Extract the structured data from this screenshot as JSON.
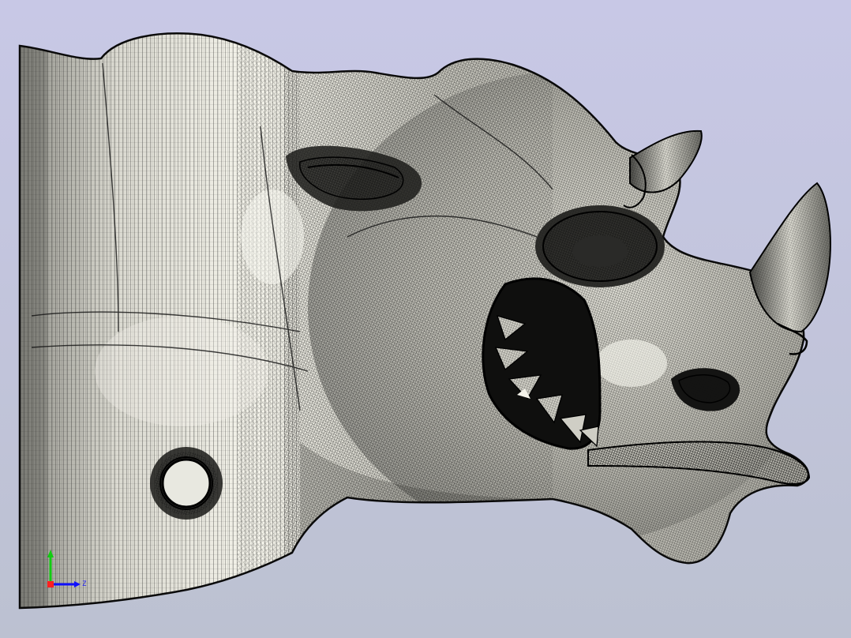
{
  "viewport": {
    "background_top": "#c8c8e6",
    "background_bottom": "#bcc1d1"
  },
  "model": {
    "display_mode": "shaded-with-edges",
    "surface_color": "#ecebe1",
    "edge_color": "#111111"
  },
  "triad": {
    "x_axis": {
      "label": "",
      "color": "#1010ff"
    },
    "y_axis": {
      "label": "",
      "color": "#11cc11"
    },
    "z_axis": {
      "label": "Z",
      "color": "#2222ee"
    },
    "origin_color": "#ff2020"
  }
}
